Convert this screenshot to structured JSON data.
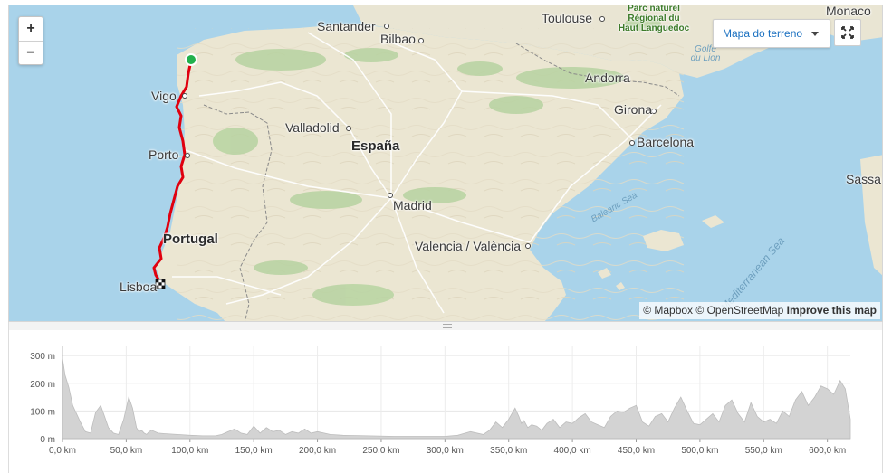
{
  "map": {
    "zoom_in_label": "+",
    "zoom_out_label": "−",
    "map_type_label": "Mapa do terreno",
    "attribution": {
      "mapbox": "© Mapbox",
      "osm": "© OpenStreetMap",
      "improve": "Improve this map"
    },
    "labels": [
      {
        "text": "Santander",
        "kind": "city"
      },
      {
        "text": "Bilbao",
        "kind": "city"
      },
      {
        "text": "Toulouse",
        "kind": "city"
      },
      {
        "text": "Monaco",
        "kind": "city"
      },
      {
        "text": "Parc naturel Régional du Haut Languedoc",
        "kind": "park"
      },
      {
        "text": "Golfe du Lion",
        "kind": "sea"
      },
      {
        "text": "Andorra",
        "kind": "city"
      },
      {
        "text": "Vigo",
        "kind": "city"
      },
      {
        "text": "Girona",
        "kind": "city"
      },
      {
        "text": "Valladolid",
        "kind": "city"
      },
      {
        "text": "Barcelona",
        "kind": "city"
      },
      {
        "text": "España",
        "kind": "country"
      },
      {
        "text": "Porto",
        "kind": "city"
      },
      {
        "text": "Sassa",
        "kind": "city"
      },
      {
        "text": "Madrid",
        "kind": "city"
      },
      {
        "text": "Balearic Sea",
        "kind": "sea"
      },
      {
        "text": "Portugal",
        "kind": "country"
      },
      {
        "text": "Valencia / València",
        "kind": "city"
      },
      {
        "text": "Mediterranean Sea",
        "kind": "sea"
      },
      {
        "text": "Lisboa",
        "kind": "city"
      }
    ],
    "route_color": "#e0000f",
    "start_marker_color": "#22b14c"
  },
  "elevation": {
    "y_ticks": [
      "300 m",
      "200 m",
      "100 m",
      "0 m"
    ],
    "x_ticks": [
      "0,0 km",
      "50,0 km",
      "100,0 km",
      "150,0 km",
      "200,0 km",
      "250,0 km",
      "300,0 km",
      "350,0 km",
      "400,0 km",
      "450,0 km",
      "500,0 km",
      "550,0 km",
      "600,0 km"
    ]
  },
  "chart_data": {
    "type": "area",
    "title": "",
    "xlabel": "",
    "ylabel": "",
    "x_unit": "km",
    "y_unit": "m",
    "xlim": [
      0,
      618
    ],
    "ylim": [
      0,
      320
    ],
    "grid": true,
    "series": [
      {
        "x": [
          0,
          2,
          5,
          8,
          10,
          14,
          18,
          22,
          26,
          30,
          33,
          36,
          40,
          44,
          48,
          52,
          55,
          58,
          60,
          62,
          64,
          66,
          68,
          70,
          75,
          80,
          90,
          100,
          110,
          120,
          125,
          130,
          135,
          140,
          145,
          150,
          155,
          160,
          165,
          170,
          175,
          180,
          185,
          190,
          195,
          200,
          210,
          220,
          240,
          260,
          280,
          300,
          310,
          320,
          330,
          335,
          340,
          345,
          350,
          355,
          358,
          360,
          362,
          365,
          368,
          372,
          376,
          380,
          385,
          390,
          395,
          400,
          405,
          410,
          415,
          420,
          425,
          430,
          435,
          440,
          445,
          450,
          455,
          460,
          465,
          470,
          475,
          480,
          485,
          490,
          495,
          500,
          505,
          510,
          515,
          520,
          525,
          530,
          535,
          540,
          545,
          550,
          555,
          560,
          565,
          570,
          575,
          580,
          585,
          590,
          595,
          600,
          605,
          610,
          614,
          618
        ],
        "y": [
          290,
          230,
          185,
          120,
          100,
          60,
          25,
          20,
          95,
          120,
          80,
          40,
          20,
          15,
          70,
          150,
          110,
          40,
          25,
          30,
          20,
          15,
          25,
          30,
          20,
          18,
          15,
          12,
          10,
          10,
          15,
          25,
          35,
          20,
          15,
          45,
          20,
          40,
          25,
          30,
          15,
          25,
          20,
          35,
          20,
          25,
          15,
          12,
          10,
          8,
          8,
          8,
          12,
          25,
          15,
          30,
          60,
          40,
          70,
          110,
          80,
          55,
          65,
          40,
          50,
          45,
          30,
          55,
          70,
          40,
          60,
          55,
          75,
          90,
          60,
          50,
          40,
          80,
          100,
          95,
          110,
          120,
          60,
          45,
          80,
          90,
          60,
          110,
          150,
          100,
          55,
          50,
          70,
          90,
          60,
          120,
          140,
          90,
          60,
          130,
          80,
          60,
          70,
          55,
          100,
          80,
          140,
          170,
          120,
          150,
          190,
          180,
          160,
          210,
          180,
          70
        ]
      }
    ]
  }
}
